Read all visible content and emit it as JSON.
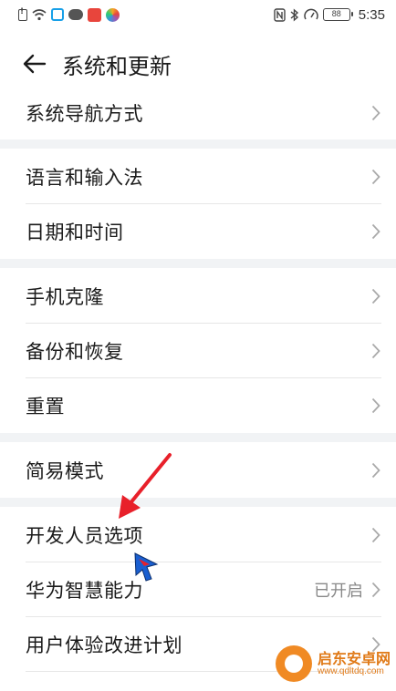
{
  "status_bar": {
    "battery": "88",
    "time": "5:35"
  },
  "header": {
    "title": "系统和更新"
  },
  "sections": [
    {
      "items": [
        {
          "label": "系统导航方式"
        }
      ]
    },
    {
      "items": [
        {
          "label": "语言和输入法"
        },
        {
          "label": "日期和时间"
        }
      ]
    },
    {
      "items": [
        {
          "label": "手机克隆"
        },
        {
          "label": "备份和恢复"
        },
        {
          "label": "重置"
        }
      ]
    },
    {
      "items": [
        {
          "label": "简易模式"
        }
      ]
    },
    {
      "items": [
        {
          "label": "开发人员选项"
        },
        {
          "label": "华为智慧能力",
          "value": "已开启"
        },
        {
          "label": "用户体验改进计划"
        }
      ]
    }
  ],
  "watermark": {
    "name": "启东安卓网",
    "url": "www.qdltdq.com"
  },
  "colors": {
    "annotation_arrow": "#e8202a",
    "cursor": "#1a5fd0",
    "section_gap": "#f1f3f5"
  }
}
